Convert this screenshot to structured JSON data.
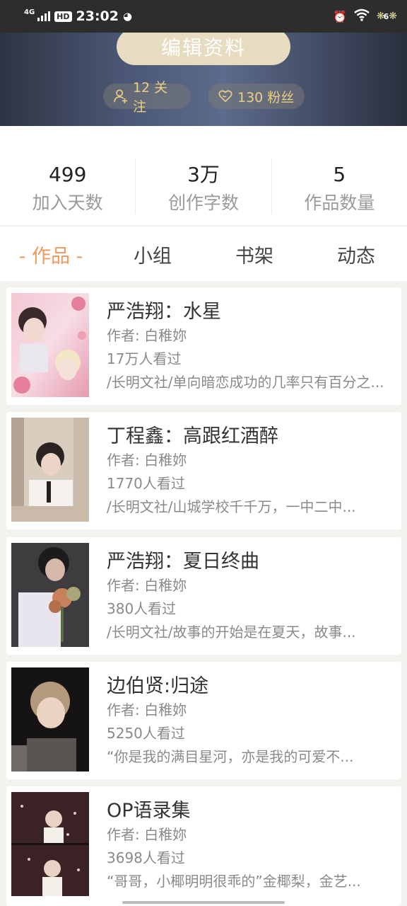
{
  "status_bar": {
    "network": "4G",
    "hd": "HD",
    "time": "23:02",
    "battery": "6"
  },
  "profile": {
    "edit_button": "编辑资料",
    "follow": "12 关注",
    "fans": "130 粉丝"
  },
  "stats": [
    {
      "value": "499",
      "label": "加入天数"
    },
    {
      "value": "3万",
      "label": "创作字数"
    },
    {
      "value": "5",
      "label": "作品数量"
    }
  ],
  "tabs": [
    {
      "label": "- 作品 -",
      "active": true
    },
    {
      "label": "小组",
      "active": false
    },
    {
      "label": "书架",
      "active": false
    },
    {
      "label": "动态",
      "active": false
    }
  ],
  "works": [
    {
      "title": "严浩翔：水星",
      "author": "作者: 白稚妳",
      "views": "17万人看过",
      "desc": "/长明文社/单向暗恋成功的几率只有百分之..."
    },
    {
      "title": "丁程鑫：高跟红酒醉",
      "author": "作者: 白稚妳",
      "views": "1770人看过",
      "desc": "/长明文社/山城学校千千万，一中二中..."
    },
    {
      "title": "严浩翔：夏日终曲",
      "author": "作者: 白稚妳",
      "views": "380人看过",
      "desc": "/长明文社/故事的开始是在夏天，故事..."
    },
    {
      "title": "边伯贤:归途",
      "author": "作者: 白稚妳",
      "views": "5250人看过",
      "desc": "“你是我的满目星河，亦是我的可爱不..."
    },
    {
      "title": "OP语录集",
      "author": "作者: 白稚妳",
      "views": "3698人看过",
      "desc": "“哥哥，小椰明明很乖的”金椰梨，金艺..."
    }
  ],
  "colors": {
    "accent": "#f0995a",
    "pill_text": "#e9cf86",
    "edit_button_bg": "#e7dcc0"
  }
}
